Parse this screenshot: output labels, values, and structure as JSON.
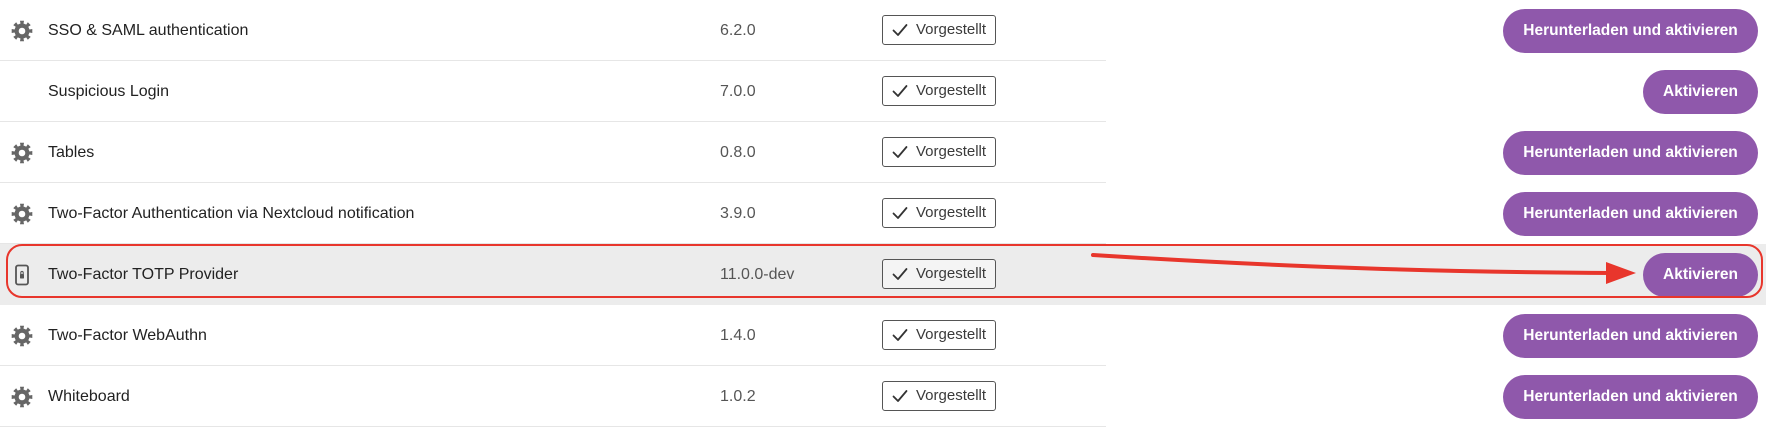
{
  "colors": {
    "accent": "#8f58ab",
    "annotation": "#e8362c",
    "highlight_row": "#ececec"
  },
  "apps": [
    {
      "name": "SSO & SAML authentication",
      "version": "6.2.0",
      "badge": "Vorgestellt",
      "action": "Herunterladen und aktivieren",
      "icon": "gear-icon",
      "highlighted": false
    },
    {
      "name": "Suspicious Login",
      "version": "7.0.0",
      "badge": "Vorgestellt",
      "action": "Aktivieren",
      "icon": "",
      "highlighted": false
    },
    {
      "name": "Tables",
      "version": "0.8.0",
      "badge": "Vorgestellt",
      "action": "Herunterladen und aktivieren",
      "icon": "gear-icon",
      "highlighted": false
    },
    {
      "name": "Two-Factor Authentication via Nextcloud notification",
      "version": "3.9.0",
      "badge": "Vorgestellt",
      "action": "Herunterladen und aktivieren",
      "icon": "gear-icon",
      "highlighted": false
    },
    {
      "name": "Two-Factor TOTP Provider",
      "version": "11.0.0-dev",
      "badge": "Vorgestellt",
      "action": "Aktivieren",
      "icon": "phone-lock-icon",
      "highlighted": true
    },
    {
      "name": "Two-Factor WebAuthn",
      "version": "1.4.0",
      "badge": "Vorgestellt",
      "action": "Herunterladen und aktivieren",
      "icon": "gear-icon",
      "highlighted": false
    },
    {
      "name": "Whiteboard",
      "version": "1.0.2",
      "badge": "Vorgestellt",
      "action": "Herunterladen und aktivieren",
      "icon": "gear-icon",
      "highlighted": false
    }
  ]
}
